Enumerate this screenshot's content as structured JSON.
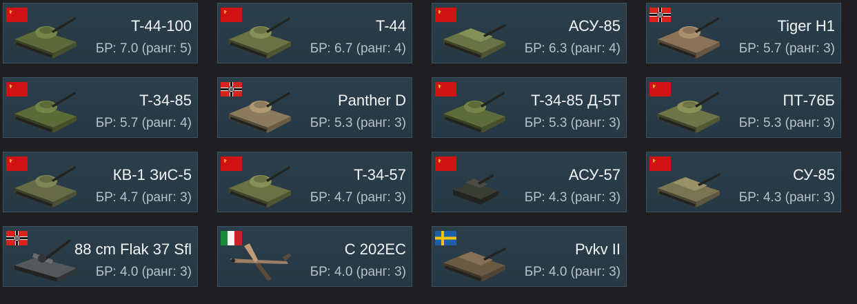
{
  "vehicles": [
    {
      "name": "T-44-100",
      "br": "БР: 7.0 (ранг: 5)",
      "nation": "ussr",
      "kind": "tank",
      "hull": "#5f6a3a"
    },
    {
      "name": "T-44",
      "br": "БР: 6.7 (ранг: 4)",
      "nation": "ussr",
      "kind": "tank",
      "hull": "#6b7244"
    },
    {
      "name": "АСУ-85",
      "br": "БР: 6.3 (ранг: 4)",
      "nation": "ussr",
      "kind": "spg",
      "hull": "#6a7346"
    },
    {
      "name": "Tiger H1",
      "br": "БР: 5.7 (ранг: 3)",
      "nation": "germany",
      "kind": "tank",
      "hull": "#8a7358"
    },
    {
      "name": "T-34-85",
      "br": "БР: 5.7 (ранг: 4)",
      "nation": "ussr",
      "kind": "tank",
      "hull": "#5c6a38"
    },
    {
      "name": "Panther D",
      "br": "БР: 5.3 (ранг: 3)",
      "nation": "germany",
      "kind": "tank",
      "hull": "#8b7a5c"
    },
    {
      "name": "T-34-85 Д-5Т",
      "br": "БР: 5.3 (ранг: 3)",
      "nation": "ussr",
      "kind": "tank",
      "hull": "#5e6b3a"
    },
    {
      "name": "ПТ-76Б",
      "br": "БР: 5.3 (ранг: 3)",
      "nation": "ussr",
      "kind": "light",
      "hull": "#6e7546"
    },
    {
      "name": "КВ-1 ЗиС-5",
      "br": "БР: 4.7 (ранг: 3)",
      "nation": "ussr",
      "kind": "tank",
      "hull": "#666b45"
    },
    {
      "name": "T-34-57",
      "br": "БР: 4.7 (ранг: 3)",
      "nation": "ussr",
      "kind": "tank",
      "hull": "#6a7245"
    },
    {
      "name": "АСУ-57",
      "br": "БР: 4.3 (ранг: 3)",
      "nation": "ussr",
      "kind": "small",
      "hull": "#3a3d33"
    },
    {
      "name": "СУ-85",
      "br": "БР: 4.3 (ранг: 3)",
      "nation": "ussr",
      "kind": "spg",
      "hull": "#7a7452"
    },
    {
      "name": "88 cm Flak 37 Sfl",
      "br": "БР: 4.0 (ранг: 3)",
      "nation": "germany",
      "kind": "aa",
      "hull": "#55585a"
    },
    {
      "name": "C 202EC",
      "br": "БР: 4.0 (ранг: 3)",
      "nation": "italy",
      "kind": "plane",
      "hull": "#9a7d62"
    },
    {
      "name": "Pvkv II",
      "br": "БР: 4.0 (ранг: 3)",
      "nation": "sweden",
      "kind": "spg",
      "hull": "#6a5a44"
    }
  ],
  "colors": {
    "card_bg": "#2b3f4b",
    "card_border": "#3d5361",
    "name_text": "#f2f5f7",
    "br_text": "#b6c2ca",
    "ussr_flag": "#d01212",
    "germany_flag": "#d8231c",
    "sweden_blue": "#1f5ea8",
    "sweden_yellow": "#f5c400"
  }
}
